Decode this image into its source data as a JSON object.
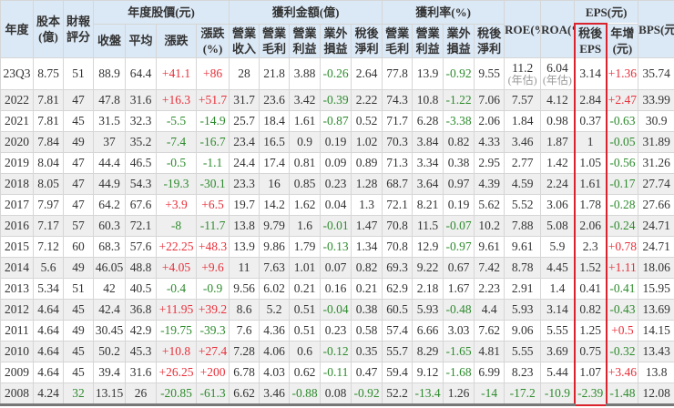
{
  "colors": {
    "positive": "#e8303a",
    "negative": "#2e8b2e",
    "highlight_box": "#d9232d",
    "header_bg": "#dbe8f5"
  },
  "headers": {
    "year": "年度",
    "capital": "股本(億)",
    "score": "財報評分",
    "price_group": "年度股價(元)",
    "close": "收盤",
    "avg": "平均",
    "change": "漲跌",
    "change_pct": "漲跌(%)",
    "profit_group": "獲利金額(億)",
    "revenue": "營業收入",
    "gross": "營業毛利",
    "op": "營業利益",
    "nonop": "業外損益",
    "net": "稅後淨利",
    "rate_group": "獲利率(%)",
    "gross_r": "營業毛利",
    "op_r": "營業利益",
    "nonop_r": "業外損益",
    "net_r": "稅後淨利",
    "roe": "ROE(%)",
    "roa": "ROA(%)",
    "eps_group": "EPS(元)",
    "eps": "稅後EPS",
    "eps_yoy": "年增(元)",
    "bps": "BPS(元)"
  },
  "estimate_note": "(年估)",
  "rows": [
    [
      "23Q3",
      "8.75",
      "51",
      "88.9",
      "64.4",
      "+41.1",
      "+86",
      "28",
      "21.8",
      "3.88",
      "-0.26",
      "2.64",
      "77.8",
      "13.9",
      "-0.92",
      "9.55",
      "11.2",
      "6.04",
      "3.14",
      "+1.36",
      "35.74"
    ],
    [
      "2022",
      "7.81",
      "47",
      "47.8",
      "31.6",
      "+16.3",
      "+51.7",
      "31.7",
      "23.6",
      "3.42",
      "-0.39",
      "2.22",
      "74.3",
      "10.8",
      "-1.22",
      "7.06",
      "7.57",
      "4.12",
      "2.84",
      "+2.47",
      "33.99"
    ],
    [
      "2021",
      "7.81",
      "45",
      "31.5",
      "32.3",
      "-5.5",
      "-14.9",
      "25.7",
      "18.4",
      "1.61",
      "-0.87",
      "0.52",
      "71.7",
      "6.28",
      "-3.38",
      "2.06",
      "1.84",
      "0.98",
      "0.37",
      "-0.63",
      "30.9"
    ],
    [
      "2020",
      "7.84",
      "49",
      "37",
      "35.2",
      "-7.4",
      "-16.7",
      "23.4",
      "16.5",
      "0.9",
      "0.19",
      "1.02",
      "70.3",
      "3.84",
      "0.82",
      "4.33",
      "3.46",
      "1.87",
      "1",
      "-0.05",
      "31.89"
    ],
    [
      "2019",
      "8.04",
      "47",
      "44.4",
      "46.5",
      "-0.5",
      "-1.1",
      "24.4",
      "17.4",
      "0.81",
      "0.09",
      "0.89",
      "71.3",
      "3.34",
      "0.38",
      "2.95",
      "2.77",
      "1.42",
      "1.05",
      "-0.56",
      "31.26"
    ],
    [
      "2018",
      "8.05",
      "47",
      "44.9",
      "54.3",
      "-19.3",
      "-30.1",
      "23.3",
      "16",
      "0.85",
      "0.23",
      "1.28",
      "68.7",
      "3.64",
      "0.97",
      "4.39",
      "4.59",
      "2.24",
      "1.61",
      "-0.17",
      "27.74"
    ],
    [
      "2017",
      "7.97",
      "47",
      "64.2",
      "67.6",
      "+3.9",
      "+6.5",
      "19.7",
      "14.2",
      "1.62",
      "0.04",
      "1.3",
      "72.1",
      "8.21",
      "0.19",
      "5.62",
      "5.52",
      "3.06",
      "1.78",
      "-0.28",
      "27.66"
    ],
    [
      "2016",
      "7.17",
      "57",
      "60.3",
      "72.1",
      "-8",
      "-11.7",
      "13.8",
      "9.79",
      "1.6",
      "-0.01",
      "1.47",
      "70.8",
      "11.5",
      "-0.07",
      "10.2",
      "7.88",
      "5.08",
      "2.06",
      "-0.24",
      "24.71"
    ],
    [
      "2015",
      "7.12",
      "60",
      "68.3",
      "57.6",
      "+22.25",
      "+48.3",
      "13.9",
      "9.86",
      "1.79",
      "-0.13",
      "1.34",
      "70.8",
      "12.9",
      "-0.97",
      "9.61",
      "9.61",
      "5.9",
      "2.3",
      "+0.78",
      "24.71"
    ],
    [
      "2014",
      "5.6",
      "49",
      "46.05",
      "48.8",
      "+4.05",
      "+9.6",
      "11",
      "7.63",
      "1.01",
      "0.07",
      "0.82",
      "69.3",
      "9.22",
      "0.67",
      "7.42",
      "8.78",
      "4.45",
      "1.52",
      "+1.11",
      "18.06"
    ],
    [
      "2013",
      "5.34",
      "51",
      "42",
      "40.5",
      "-0.4",
      "-0.9",
      "9.56",
      "6.02",
      "0.21",
      "0.16",
      "0.21",
      "62.9",
      "2.18",
      "1.67",
      "2.23",
      "2.91",
      "1.4",
      "0.41",
      "-0.41",
      "15.95"
    ],
    [
      "2012",
      "4.64",
      "45",
      "42.4",
      "36.8",
      "+11.95",
      "+39.2",
      "8.6",
      "5.2",
      "0.51",
      "-0.04",
      "0.38",
      "60.5",
      "5.93",
      "-0.48",
      "4.4",
      "5.93",
      "3.14",
      "0.82",
      "-0.43",
      "13.69"
    ],
    [
      "2011",
      "4.64",
      "49",
      "30.45",
      "42.9",
      "-19.75",
      "-39.3",
      "7.6",
      "4.36",
      "0.51",
      "0.23",
      "0.58",
      "57.4",
      "6.66",
      "3.03",
      "7.62",
      "9.06",
      "5.55",
      "1.25",
      "+0.5",
      "14.15"
    ],
    [
      "2010",
      "4.64",
      "45",
      "50.2",
      "45.3",
      "+10.8",
      "+27.4",
      "7.28",
      "4.06",
      "0.6",
      "-0.12",
      "0.35",
      "55.7",
      "8.29",
      "-1.65",
      "4.81",
      "5.55",
      "3.69",
      "0.75",
      "-0.32",
      "13.43"
    ],
    [
      "2009",
      "4.64",
      "45",
      "39.4",
      "31.6",
      "+26.25",
      "+200",
      "6.78",
      "4.03",
      "0.62",
      "-0.11",
      "0.47",
      "59.4",
      "9.12",
      "-1.68",
      "6.99",
      "8.23",
      "5.44",
      "1.07",
      "+3.46",
      "13.8"
    ],
    [
      "2008",
      "4.24",
      "32",
      "13.15",
      "26",
      "-20.85",
      "-61.3",
      "6.62",
      "3.46",
      "-0.88",
      "0.08",
      "-0.92",
      "52.2",
      "-13.4",
      "1.26",
      "-14",
      "-17.2",
      "-10.9",
      "-2.39",
      "-1.48",
      "12.08"
    ]
  ],
  "low_score_rows": [
    "2008"
  ]
}
